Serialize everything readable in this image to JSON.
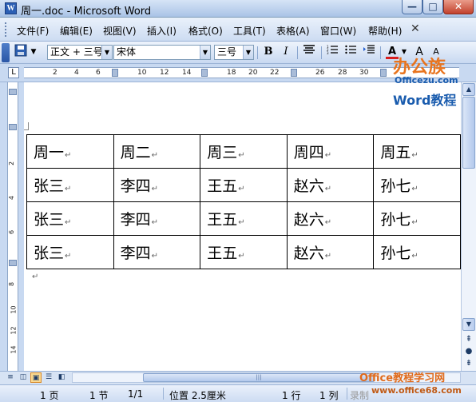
{
  "window": {
    "title": "周一.doc - Microsoft Word",
    "app_icon": "W",
    "min_label": "—",
    "max_label": "□",
    "close_label": "✕"
  },
  "menu": {
    "items": [
      {
        "label": "文件(F)"
      },
      {
        "label": "编辑(E)"
      },
      {
        "label": "视图(V)"
      },
      {
        "label": "插入(I)"
      },
      {
        "label": "格式(O)"
      },
      {
        "label": "工具(T)"
      },
      {
        "label": "表格(A)"
      },
      {
        "label": "窗口(W)"
      },
      {
        "label": "帮助(H)"
      }
    ]
  },
  "toolbar": {
    "style_value": "正文 + 三号",
    "font_value": "宋体",
    "size_value": "三号",
    "bold": "B",
    "italic": "I",
    "font_color_letter": "A",
    "grow_font": "A",
    "shrink_font": "A",
    "accent_color": "#d81e1e"
  },
  "ruler": {
    "tab_selector": "L",
    "h_numbers": [
      "2",
      "4",
      "6",
      "10",
      "12",
      "14",
      "18",
      "20",
      "22",
      "26",
      "28",
      "30"
    ],
    "v_numbers": [
      "2",
      "4",
      "6",
      "8",
      "10",
      "12",
      "14"
    ]
  },
  "table": {
    "rows": [
      [
        "周一",
        "周二",
        "周三",
        "周四",
        "周五"
      ],
      [
        "张三",
        "李四",
        "王五",
        "赵六",
        "孙七"
      ],
      [
        "张三",
        "李四",
        "王五",
        "赵六",
        "孙七"
      ],
      [
        "张三",
        "李四",
        "王五",
        "赵六",
        "孙七"
      ]
    ],
    "cell_mark": "↵"
  },
  "paragraph_mark": "↵",
  "status": {
    "page": "1 页",
    "section": "1 节",
    "page_of": "1/1",
    "position": "位置 2.5厘米",
    "line": "1 行",
    "column": "1 列",
    "record": "录制"
  },
  "watermark_top": {
    "cn": "办公族",
    "site": "Officezu.com",
    "tag": "Word教程"
  },
  "watermark_bottom": {
    "line1": "Office教程学习网",
    "line2": "www.office68.com"
  }
}
